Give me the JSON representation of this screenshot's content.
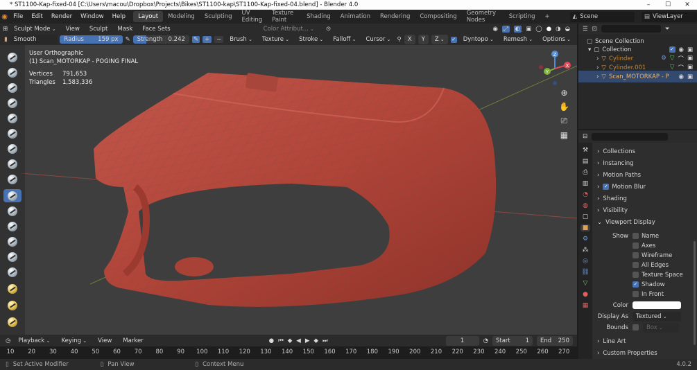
{
  "window": {
    "title": "* ST1100-Kap-fixed-04 [C:\\Users\\macou\\Dropbox\\Projects\\Bikes\\ST1100-kap\\ST1100-Kap-fixed-04.blend] - Blender 4.0",
    "min": "–",
    "max": "☐",
    "close": "✕"
  },
  "menu": [
    "File",
    "Edit",
    "Render",
    "Window",
    "Help"
  ],
  "workspaces": [
    "Layout",
    "Modeling",
    "Sculpting",
    "UV Editing",
    "Texture Paint",
    "Shading",
    "Animation",
    "Rendering",
    "Compositing",
    "Geometry Nodes",
    "Scripting"
  ],
  "active_workspace": "Layout",
  "add_workspace": "+",
  "scene": {
    "label": "Scene",
    "view_layer": "ViewLayer"
  },
  "viewport_header": {
    "mode": "Sculpt Mode",
    "menus": [
      "View",
      "Sculpt",
      "Mask",
      "Face Sets"
    ],
    "color_attr": "Color Attribut...",
    "axes": [
      "X",
      "Y",
      "Z"
    ],
    "dyntopo": "Dyntopo",
    "remesh": "Remesh",
    "options": "Options"
  },
  "tool_settings": {
    "brush": "Smooth",
    "radius_label": "Radius",
    "radius_value": "159 px",
    "strength_label": "Strength",
    "strength_value": "0.242",
    "menus": [
      "Brush",
      "Texture",
      "Stroke",
      "Falloff",
      "Cursor"
    ]
  },
  "overlay": {
    "view": "User Orthographic",
    "object": "(1) Scan_MOTORKAP - POGING FINAL",
    "vertices_label": "Vertices",
    "vertices_value": "791,653",
    "triangles_label": "Triangles",
    "triangles_value": "1,583,336",
    "gizmo_x": "X",
    "gizmo_y": "Y",
    "gizmo_z": "Z"
  },
  "outliner": {
    "root": "Scene Collection",
    "collection": "Collection",
    "items": [
      "Cylinder",
      "Cylinder.001",
      "Scan_MOTORKAP - P"
    ]
  },
  "properties": {
    "sections_top": [
      "Collections",
      "Instancing",
      "Motion Paths",
      "Motion Blur",
      "Shading",
      "Visibility",
      "Viewport Display"
    ],
    "show_label": "Show",
    "show_items": [
      "Name",
      "Axes",
      "Wireframe",
      "All Edges",
      "Texture Space",
      "Shadow",
      "In Front"
    ],
    "shadow_checked": true,
    "color_label": "Color",
    "color_value": "#ffffff",
    "display_as_label": "Display As",
    "display_as_value": "Textured",
    "bounds_label": "Bounds",
    "bounds_value": "Box",
    "sections_bottom": [
      "Line Art",
      "Custom Properties"
    ]
  },
  "timeline": {
    "menus": [
      "Playback",
      "Keying",
      "View",
      "Marker"
    ],
    "current_frame": "1",
    "start_label": "Start",
    "start_value": "1",
    "end_label": "End",
    "end_value": "250",
    "ticks": [
      "10",
      "20",
      "30",
      "40",
      "50",
      "60",
      "70",
      "80",
      "90",
      "100",
      "110",
      "120",
      "130",
      "140",
      "150",
      "160",
      "170",
      "180",
      "190",
      "200",
      "210",
      "220",
      "230",
      "240",
      "250",
      "260",
      "270"
    ]
  },
  "statusbar": {
    "left": "Set Active Modifier",
    "middle": "Pan View",
    "right": "Context Menu",
    "version": "4.0.2"
  },
  "colors": {
    "accent": "#4772b3",
    "mesh": "#b5483d",
    "viewport_bg": "#3e3e3e"
  }
}
